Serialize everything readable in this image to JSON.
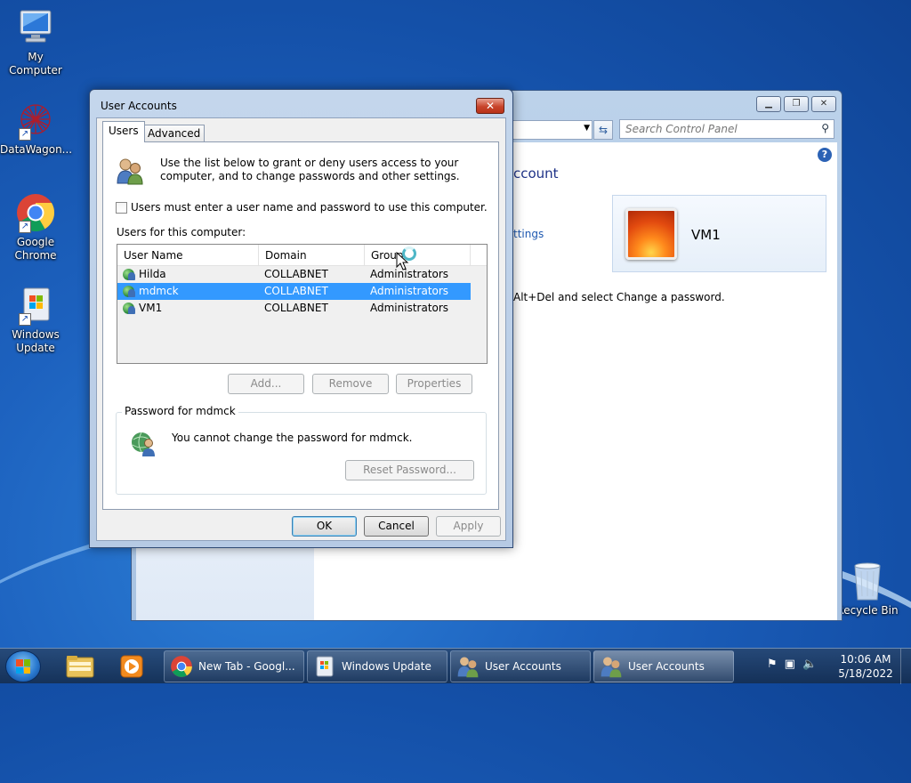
{
  "desktop": {
    "icons": [
      {
        "label": "My Computer"
      },
      {
        "label": "DataWagon..."
      },
      {
        "label": "Google Chrome"
      },
      {
        "label": "Windows Update"
      },
      {
        "label": "Recycle Bin"
      }
    ]
  },
  "control_panel": {
    "search_placeholder": "Search Control Panel",
    "heading": "ccount",
    "link": "ttings",
    "info": "Alt+Del and select Change a password.",
    "account_name": "VM1"
  },
  "dialog": {
    "title": "User Accounts",
    "tabs": [
      "Users",
      "Advanced"
    ],
    "intro": "Use the list below to grant or deny users access to your computer, and to change passwords and other settings.",
    "checkbox_label": "Users must enter a user name and password to use this computer.",
    "checkbox_checked": false,
    "users_label": "Users for this computer:",
    "columns": [
      "User Name",
      "Domain",
      "Group"
    ],
    "rows": [
      {
        "name": "Hilda",
        "domain": "COLLABNET",
        "group": "Administrators"
      },
      {
        "name": "mdmck",
        "domain": "COLLABNET",
        "group": "Administrators"
      },
      {
        "name": "VM1",
        "domain": "COLLABNET",
        "group": "Administrators"
      }
    ],
    "selected_row": "mdmck",
    "buttons": {
      "add": "Add...",
      "remove": "Remove",
      "properties": "Properties"
    },
    "password_group_title": "Password for mdmck",
    "password_message": "You cannot change the password for mdmck.",
    "reset_password": "Reset Password...",
    "ok": "OK",
    "cancel": "Cancel",
    "apply": "Apply"
  },
  "taskbar": {
    "items": [
      {
        "label": "New Tab - Googl..."
      },
      {
        "label": "Windows Update"
      },
      {
        "label": "User Accounts"
      },
      {
        "label": "User Accounts"
      }
    ],
    "time": "10:06 AM",
    "date": "5/18/2022"
  }
}
